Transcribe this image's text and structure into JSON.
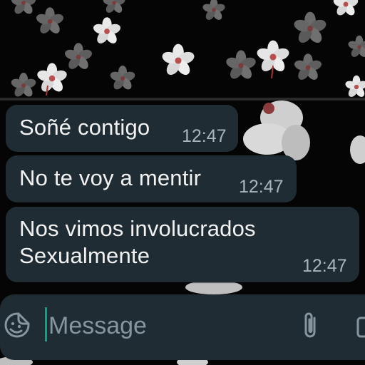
{
  "chat": {
    "messages": [
      {
        "text": "Soñé contigo",
        "time": "12:47"
      },
      {
        "text": "No te voy a mentir",
        "time": "12:47"
      },
      {
        "text": "Nos vimos involucrados\nSexualmente",
        "time": "12:47"
      }
    ]
  },
  "composer": {
    "placeholder": "Message",
    "emoji_icon": "emoji-sticker-icon",
    "attach_icon": "paperclip-icon",
    "camera_icon": "camera-icon"
  },
  "colors": {
    "bubble": "#1f2c33",
    "text": "#f2f2f2",
    "timestamp": "#a9b4ba",
    "cursor": "#00a884",
    "placeholder": "#8696a0"
  }
}
